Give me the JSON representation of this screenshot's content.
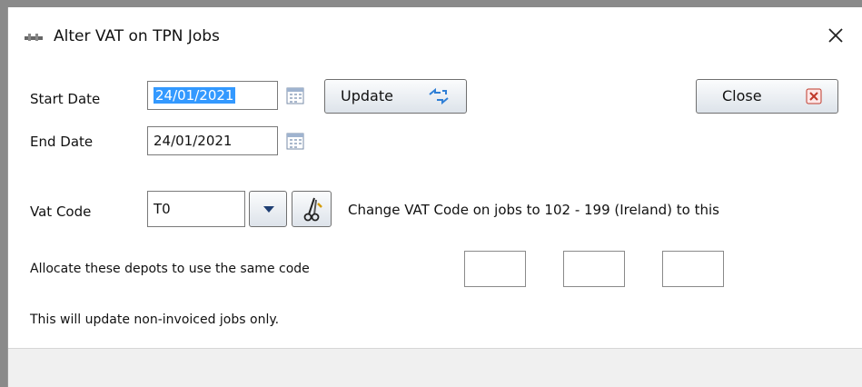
{
  "window": {
    "title": "Alter VAT on TPN Jobs"
  },
  "form": {
    "start_date_label": "Start Date",
    "start_date_value": "24/01/2021",
    "end_date_label": "End Date",
    "end_date_value": "24/01/2021",
    "vat_code_label": "Vat Code",
    "vat_code_value": "T0",
    "vat_code_description": "Change VAT Code on jobs to 102 - 199 (Ireland) to this",
    "allocate_label": "Allocate these depots to use the same code",
    "depot_values": [
      "",
      "",
      ""
    ],
    "note": "This will update non-invoiced jobs only."
  },
  "buttons": {
    "update_label": "Update",
    "close_label": "Close"
  },
  "colors": {
    "selection": "#3399ff",
    "close_icon": "#c0392b",
    "update_icon": "#2f7fd6",
    "dropdown_arrow": "#1f3f73"
  }
}
